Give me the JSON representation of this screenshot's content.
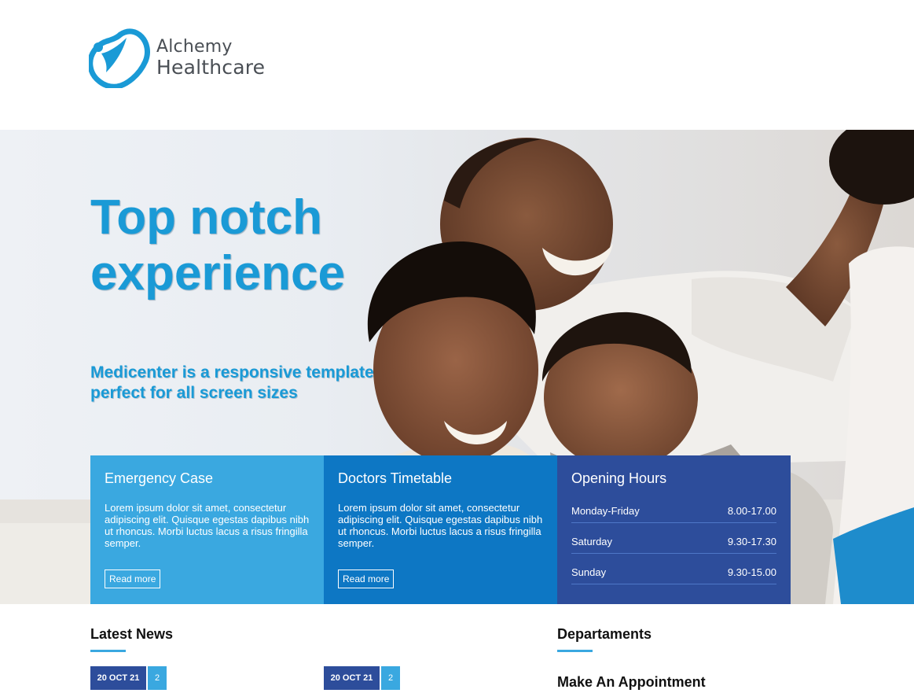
{
  "brand": {
    "line1": "Alchemy",
    "line2": "Healthcare",
    "logo_icon": "heart-figure-icon",
    "accent_color": "#1a9ad6"
  },
  "hero": {
    "title": "Top notch experience",
    "subtitle": "Medicenter is a responsive template perfect for all screen sizes"
  },
  "boxes": [
    {
      "title": "Emergency Case",
      "text": "Lorem ipsum dolor sit amet, consectetur adipiscing elit. Quisque egestas dapibus nibh ut rhoncus. Morbi luctus lacus a risus fringilla semper.",
      "button": "Read more",
      "color": "#3aa8e0"
    },
    {
      "title": "Doctors Timetable",
      "text": "Lorem ipsum dolor sit amet, consectetur adipiscing elit. Quisque egestas dapibus nibh ut rhoncus. Morbi luctus lacus a risus fringilla semper.",
      "button": "Read more",
      "color": "#0d77c4"
    },
    {
      "title": "Opening Hours",
      "hours": [
        {
          "day": "Monday-Friday",
          "time": "8.00-17.00"
        },
        {
          "day": "Saturday",
          "time": "9.30-17.30"
        },
        {
          "day": "Sunday",
          "time": "9.30-15.00"
        }
      ],
      "color": "#2d4d9b"
    }
  ],
  "latest_news": {
    "title": "Latest News",
    "items": [
      {
        "date": "20 OCT 21",
        "count": "2"
      },
      {
        "date": "20 OCT 21",
        "count": "2"
      }
    ]
  },
  "departments": {
    "title": "Departaments",
    "appointment_title": "Make An Appointment"
  }
}
